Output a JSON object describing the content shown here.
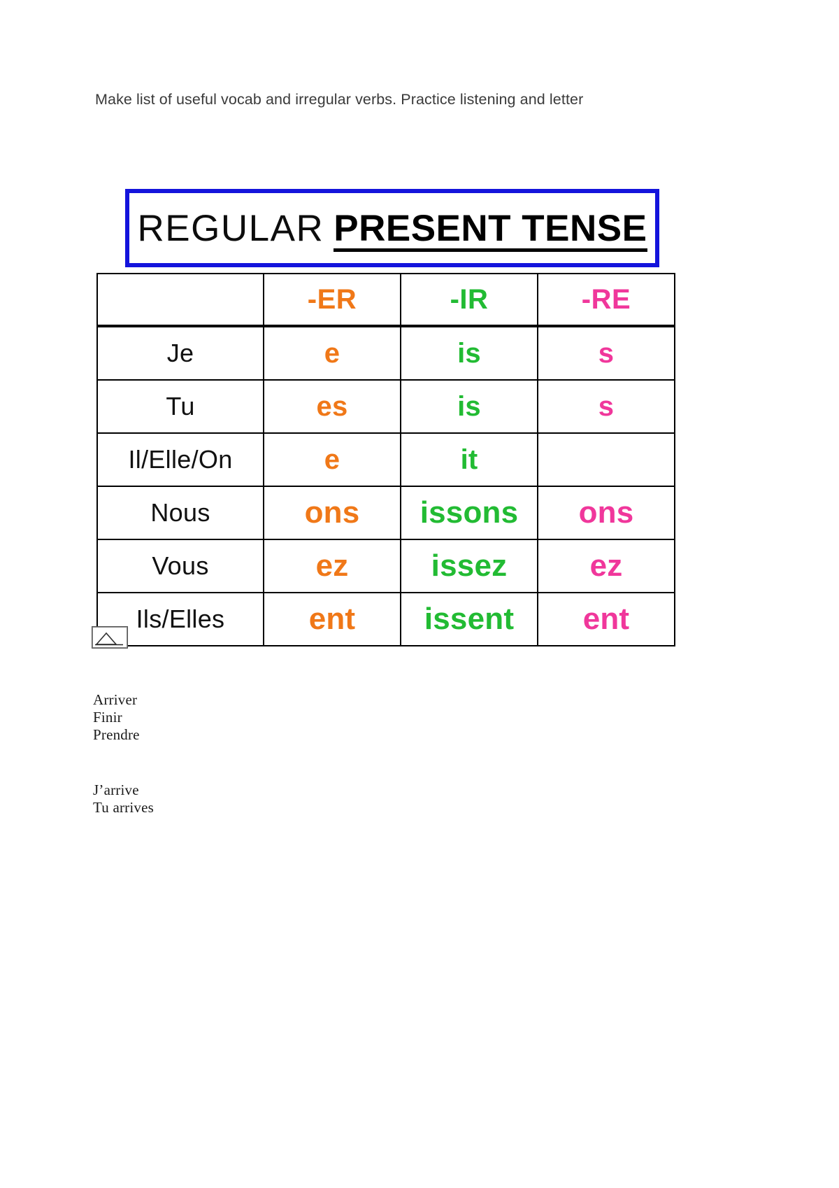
{
  "document": {
    "note": "Make list of useful vocab and irregular verbs. Practice listening and letter",
    "banner": {
      "title_regular": "REGULAR",
      "title_bold": "PRESENT TENSE",
      "border_color": "#1414dc"
    },
    "table": {
      "colors": {
        "er": "#f07818",
        "ir": "#22bb33",
        "re": "#f0379b",
        "pronoun": "#111111",
        "border": "#000000"
      },
      "columns": [
        "",
        "-ER",
        "-IR",
        "-RE"
      ],
      "rows": [
        {
          "pronoun": "Je",
          "er": "e",
          "ir": "is",
          "re": "s"
        },
        {
          "pronoun": "Tu",
          "er": "es",
          "ir": "is",
          "re": "s"
        },
        {
          "pronoun": "Il/Elle/On",
          "er": "e",
          "ir": "it",
          "re": ""
        },
        {
          "pronoun": "Nous",
          "er": "ons",
          "ir": "issons",
          "re": "ons"
        },
        {
          "pronoun": "Vous",
          "er": "ez",
          "ir": "issez",
          "re": "ez"
        },
        {
          "pronoun": "Ils/Elles",
          "er": "ent",
          "ir": "issent",
          "re": "ent"
        }
      ]
    },
    "verb_lists": {
      "infinitives": [
        "Arriver",
        "Finir",
        "Prendre"
      ],
      "conjugated": [
        "J’arrive",
        "Tu arrives"
      ]
    }
  }
}
